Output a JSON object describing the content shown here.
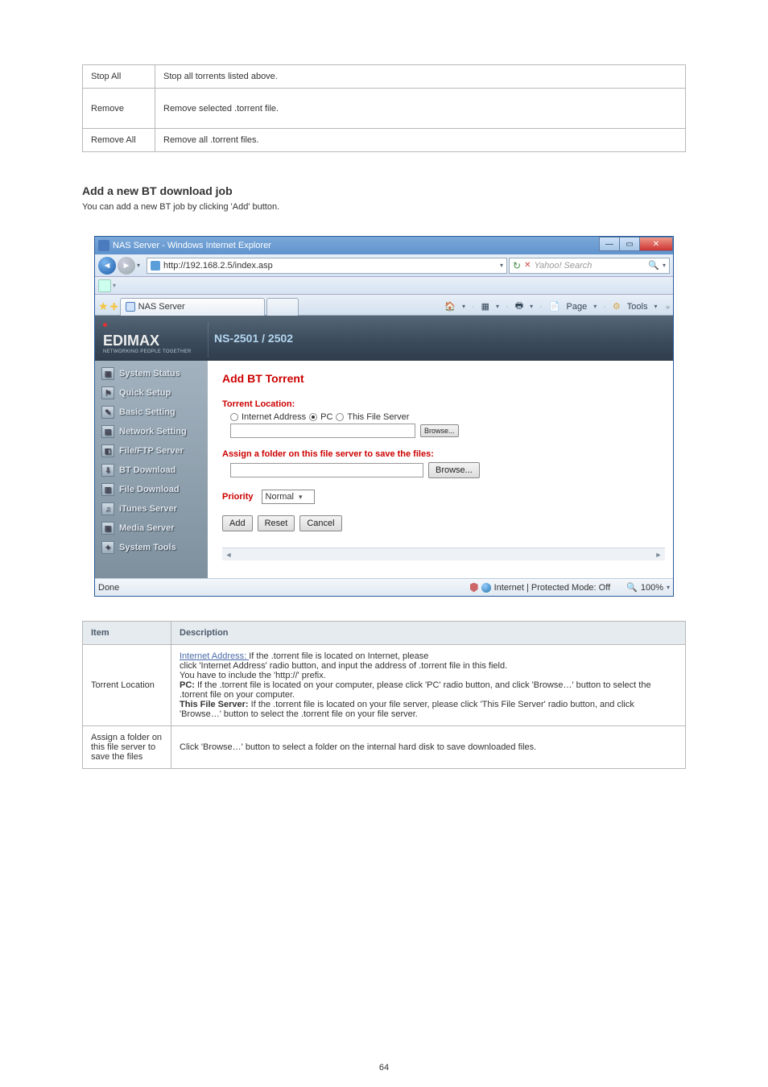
{
  "table1": {
    "rows": [
      {
        "key": "Stop All",
        "val": "Stop all torrents listed above."
      },
      {
        "key": "Remove",
        "val": "Remove selected .torrent file.",
        "tall": true
      },
      {
        "key": "Remove All",
        "val": "Remove all .torrent files."
      }
    ]
  },
  "section": {
    "heading": "Add a new BT download job",
    "desc": "You can add a new BT job by clicking 'Add' button."
  },
  "ie": {
    "title": "NAS Server - Windows Internet Explorer",
    "url": "http://192.168.2.5/index.asp",
    "search_placeholder": "Yahoo! Search",
    "tab_label": "NAS Server",
    "page_menu": "Page",
    "tools_menu": "Tools",
    "status_left": "Done",
    "status_zone": "Internet | Protected Mode: Off",
    "zoom": "100%"
  },
  "nas": {
    "brand_top": "EDIMAX",
    "brand_sub": "NETWORKING PEOPLE TOGETHER",
    "model": "NS-2501 / 2502",
    "sidebar": [
      "System Status",
      "Quick Setup",
      "Basic Setting",
      "Network Setting",
      "File/FTP Server",
      "BT Download",
      "File Download",
      "iTunes Server",
      "Media Server",
      "System Tools"
    ],
    "page": {
      "heading": "Add BT Torrent",
      "torrent_location_label": "Torrent Location:",
      "radio_internet": "Internet Address",
      "radio_pc": "PC",
      "radio_this": "This File Server",
      "browse": "Browse...",
      "assign_label": "Assign a folder on this file server to save the files:",
      "priority_label": "Priority",
      "priority_value": "Normal",
      "btn_add": "Add",
      "btn_reset": "Reset",
      "btn_cancel": "Cancel"
    }
  },
  "table2": {
    "header_item": "Item",
    "header_desc": "Description",
    "row1_key": "Torrent Location",
    "row1_internet_label": "Internet Address: ",
    "row1_internet_text": "If the .torrent file is located on Internet, please",
    "row1_internet_line2": "click 'Internet Address' radio button, and input the address of .torrent file in this field. ",
    "row1_internet_line3": "You have to include the 'http://' prefix.",
    "row1_pc_label": "PC: ",
    "row1_pc_text": "If the .torrent file is located on your computer, please click 'PC' radio button, and click 'Browse…' button to select the .torrent file on your computer.",
    "row1_this_label": "This File Server: ",
    "row1_this_text": "If the .torrent file is located on your file server, please click 'This File Server' radio button, and click 'Browse…' button to select the .torrent file on your file server.",
    "row2_key": "Assign a folder on this file server to save the files",
    "row2_text": "Click 'Browse…' button to select a folder on the internal hard disk to save downloaded files. "
  },
  "page_number": "64"
}
